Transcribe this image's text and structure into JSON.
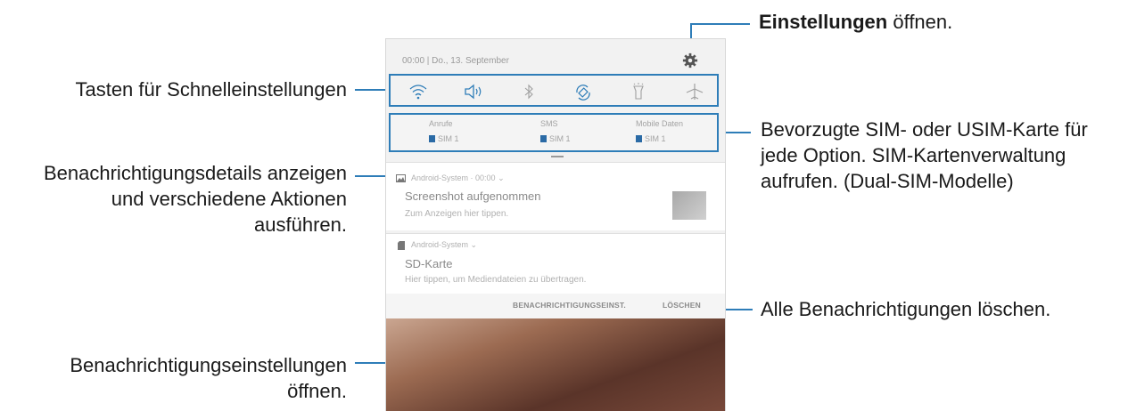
{
  "annotations": {
    "settings_bold": "Einstellungen",
    "settings_rest": " öffnen.",
    "quick_settings": "Tasten für Schnelleinstellungen",
    "details_line1": "Benachrichtigungsdetails anzeigen",
    "details_line2": "und verschiedene Aktionen",
    "details_line3": "ausführen.",
    "sim_line1": "Bevorzugte SIM- oder USIM-Karte für",
    "sim_line2": "jede Option. SIM-Kartenverwaltung",
    "sim_line3": "aufrufen. (Dual-SIM-Modelle)",
    "clear_all": "Alle Benachrichtigungen löschen.",
    "notif_settings_line1": "Benachrichtigungseinstellungen",
    "notif_settings_line2": "öffnen."
  },
  "phone": {
    "status": "00:00 | Do., 13. September",
    "quick_icons": [
      "wifi-icon",
      "sound-icon",
      "bluetooth-icon",
      "auto-rotate-icon",
      "flashlight-icon",
      "airplane-mode-icon"
    ],
    "sim": [
      {
        "label": "Anrufe",
        "value": "SIM 1"
      },
      {
        "label": "SMS",
        "value": "SIM 1"
      },
      {
        "label": "Mobile Daten",
        "value": "SIM 1"
      }
    ],
    "notifications": [
      {
        "source": "Android-System · 00:00",
        "title": "Screenshot aufgenommen",
        "text": "Zum Anzeigen hier tippen."
      },
      {
        "source": "Android-System",
        "title": "SD-Karte",
        "text": "Hier tippen, um Mediendateien zu übertragen."
      }
    ],
    "buttons": {
      "settings": "BENACHRICHTIGUNGSEINST.",
      "clear": "LÖSCHEN"
    }
  },
  "colors": {
    "accent": "#2e7db8"
  }
}
